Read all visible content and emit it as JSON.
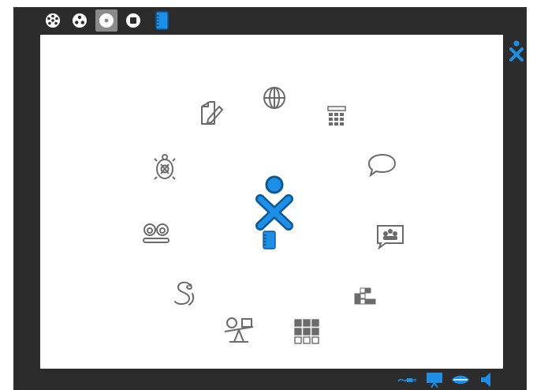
{
  "zoom_levels": [
    {
      "name": "neighborhood-view",
      "selected": false
    },
    {
      "name": "group-view",
      "selected": false
    },
    {
      "name": "home-view",
      "selected": true
    },
    {
      "name": "activity-view",
      "selected": false
    },
    {
      "name": "journal-view",
      "selected": false
    }
  ],
  "activities": [
    {
      "name": "write-activity-icon"
    },
    {
      "name": "browse-activity-icon"
    },
    {
      "name": "calculate-activity-icon"
    },
    {
      "name": "chat-activity-icon"
    },
    {
      "name": "turtleart-activity-icon"
    },
    {
      "name": "record-activity-icon"
    },
    {
      "name": "shared-chat-activity-icon"
    },
    {
      "name": "pippy-activity-icon"
    },
    {
      "name": "blocks-activity-icon"
    },
    {
      "name": "physics-activity-icon"
    },
    {
      "name": "memorize-activity-icon"
    }
  ],
  "colors": {
    "frame": "#2c2c2c",
    "accent": "#1d8fe6",
    "accent_dark": "#0a5a9a",
    "icon_gray": "#6b6b6b"
  },
  "devices": [
    {
      "name": "network-icon"
    },
    {
      "name": "display-icon"
    },
    {
      "name": "speech-icon"
    },
    {
      "name": "speaker-icon"
    }
  ]
}
